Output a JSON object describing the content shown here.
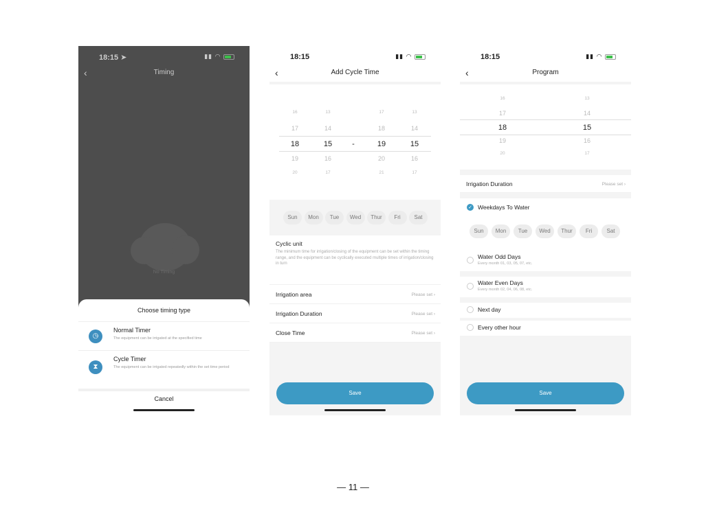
{
  "page": {
    "number": "— 11 —"
  },
  "screen1": {
    "status": {
      "time": "18:15 ➤"
    },
    "nav": {
      "back": "‹",
      "title": "Timing"
    },
    "empty_label": "No Timing",
    "sheet": {
      "title": "Choose timing type",
      "items": [
        {
          "label": "Normal Timer",
          "desc": "The equipment can be irrigated at the specified time",
          "icon": "clock-icon"
        },
        {
          "label": "Cycle Timer",
          "desc": "The equipment can be irrigated repeatedly within the set time period",
          "icon": "hourglass-icon"
        }
      ],
      "cancel": "Cancel"
    }
  },
  "screen2": {
    "status": {
      "time": "18:15"
    },
    "nav": {
      "back": "‹",
      "title": "Add Cycle Time"
    },
    "picker": {
      "cols": [
        [
          "16",
          "17",
          "18",
          "19",
          "20"
        ],
        [
          "13",
          "14",
          "15",
          "16",
          "17"
        ],
        [
          "17",
          "18",
          "19",
          "20",
          "21"
        ],
        [
          "13",
          "14",
          "15",
          "16",
          "17"
        ]
      ],
      "dash": "-"
    },
    "days": [
      "Sun",
      "Mon",
      "Tue",
      "Wed",
      "Thur",
      "Fri",
      "Sat"
    ],
    "cyclic": {
      "title": "Cyclic unit",
      "desc": "The minimum time for irrigation/closing of the equipment can be set within the timing range, and the equipment can be cyclically executed multiple times of irrigation/closing in turn"
    },
    "rows": [
      {
        "label": "Irrigation area",
        "value": "Please set ›"
      },
      {
        "label": "Irrigation  Duration",
        "value": "Please set ›"
      },
      {
        "label": "Close Time",
        "value": "Please set ›"
      }
    ],
    "save": "Save"
  },
  "screen3": {
    "status": {
      "time": "18:15"
    },
    "nav": {
      "back": "‹",
      "title": "Program"
    },
    "picker": {
      "cols": [
        [
          "16",
          "17",
          "18",
          "19",
          "20"
        ],
        [
          "13",
          "14",
          "15",
          "16",
          "17"
        ]
      ]
    },
    "duration": {
      "label": "Irrigation  Duration",
      "value": "Please set ›"
    },
    "weekdays_label": "Weekdays To Water",
    "days": [
      "Sun",
      "Mon",
      "Tue",
      "Wed",
      "Thur",
      "Fri",
      "Sat"
    ],
    "options": [
      {
        "label": "Water Odd Days",
        "desc": "Every month 01, 03, 05, 07, etc."
      },
      {
        "label": "Water Even Days",
        "desc": "Every month 02, 04, 06, 08, etc."
      },
      {
        "label": "Next day",
        "desc": ""
      },
      {
        "label": "Every other hour",
        "desc": ""
      }
    ],
    "save": "Save"
  },
  "colors": {
    "accent": "#3d9ac4",
    "dark_bg": "#4d4d4d"
  }
}
